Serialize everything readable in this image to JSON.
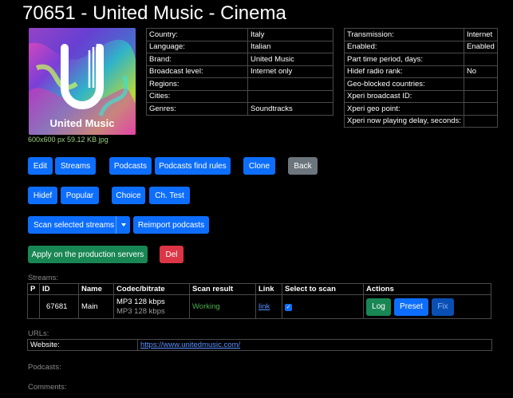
{
  "page_title": "70651 - United Music - Cinema",
  "logo": {
    "brand_text": "United Music",
    "caption": "600x600 px 59.12 KB jpg"
  },
  "info_left": [
    {
      "label": "Country:",
      "value": "Italy"
    },
    {
      "label": "Language:",
      "value": "Italian"
    },
    {
      "label": "Brand:",
      "value": "United Music"
    },
    {
      "label": "Broadcast level:",
      "value": "Internet only"
    },
    {
      "label": "Regions:",
      "value": ""
    },
    {
      "label": "Cities:",
      "value": ""
    },
    {
      "label": "Genres:",
      "value": "Soundtracks"
    }
  ],
  "info_right": [
    {
      "label": "Transmission:",
      "value": "Internet"
    },
    {
      "label": "Enabled:",
      "value": "Enabled"
    },
    {
      "label": "Part time period, days:",
      "value": ""
    },
    {
      "label": "Hidef radio rank:",
      "value": "No"
    },
    {
      "label": "Geo-blocked countries:",
      "value": ""
    },
    {
      "label": "Xperi broadcast ID:",
      "value": ""
    },
    {
      "label": "Xperi geo point:",
      "value": ""
    },
    {
      "label": "Xperi now playing delay, seconds:",
      "value": ""
    }
  ],
  "buttons": {
    "edit": "Edit",
    "streams": "Streams",
    "podcasts": "Podcasts",
    "podcasts_find_rules": "Podcasts find rules",
    "clone": "Clone",
    "back": "Back",
    "hidef": "Hidef",
    "popular": "Popular",
    "choice": "Choice",
    "ch_test": "Ch. Test",
    "scan_selected_streams": "Scan selected streams",
    "reimport_podcasts": "Reimport podcasts",
    "apply_production": "Apply on the production servers",
    "del": "Del"
  },
  "streams_section": {
    "label": "Streams:",
    "headers": [
      "P",
      "ID",
      "Name",
      "Codec/bitrate",
      "Scan result",
      "Link",
      "Select to scan",
      "Actions"
    ],
    "rows": [
      {
        "p": "",
        "id": "67681",
        "name": "Main",
        "codec1": "MP3 128 kbps",
        "codec2": "MP3 128 kbps",
        "scan_result": "Working",
        "link": "link",
        "selected": true,
        "actions": {
          "log": "Log",
          "preset": "Preset",
          "fix": "Fix"
        }
      }
    ]
  },
  "urls_section": {
    "label": "URLs:",
    "rows": [
      {
        "label": "Website:",
        "value": "https://www.unitedmusic.com/"
      }
    ]
  },
  "podcasts_label": "Podcasts:",
  "comments_label": "Comments:",
  "colors": {
    "working": "#4caf50",
    "link": "#5b8fff",
    "caption": "#9ad17e"
  }
}
